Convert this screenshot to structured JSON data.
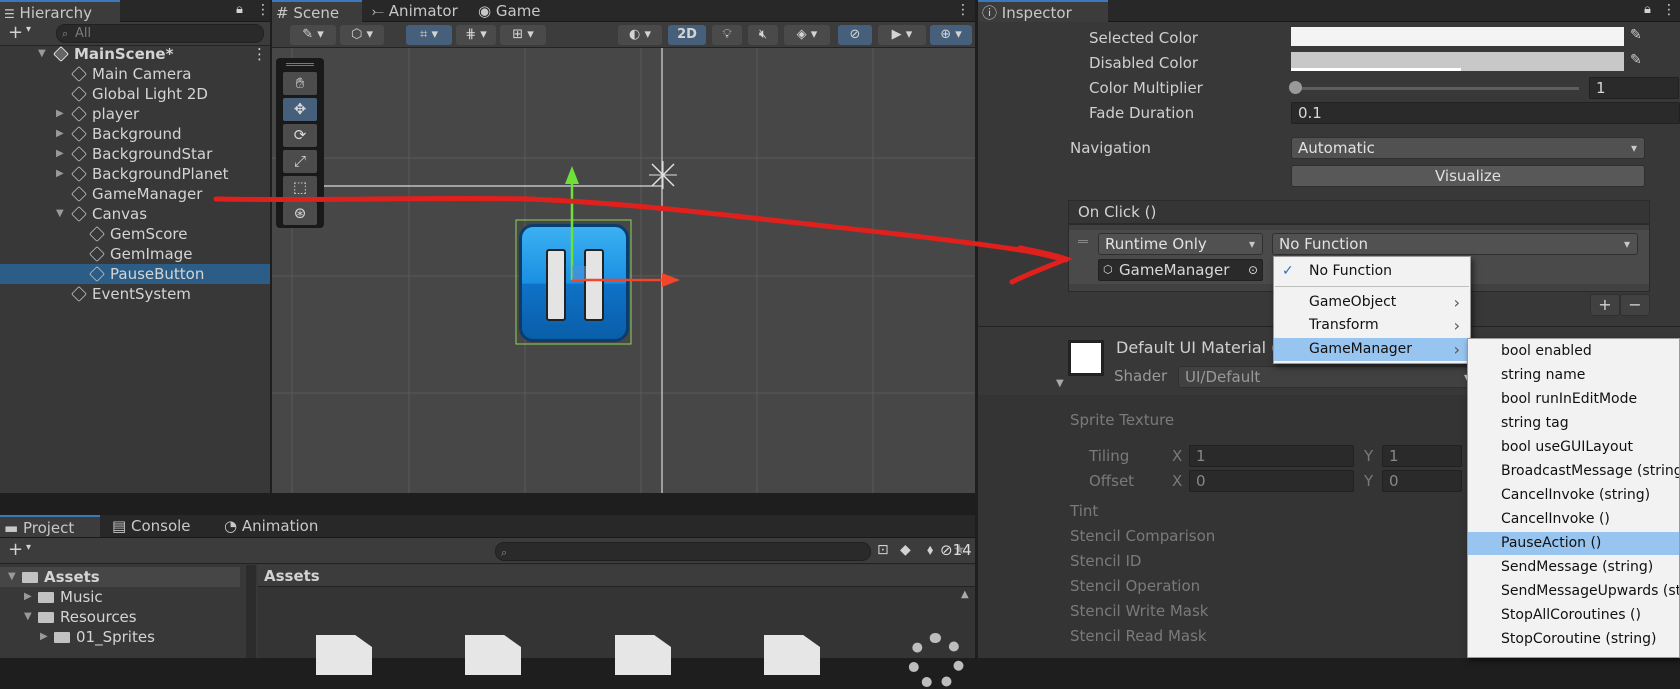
{
  "hierarchy": {
    "tab": "Hierarchy",
    "search_placeholder": "All",
    "items": [
      {
        "label": "MainScene*",
        "indent": 0,
        "arrow": "open",
        "bold": true,
        "scene": true
      },
      {
        "label": "Main Camera",
        "indent": 1,
        "arrow": ""
      },
      {
        "label": "Global Light 2D",
        "indent": 1,
        "arrow": ""
      },
      {
        "label": "player",
        "indent": 1,
        "arrow": "closed"
      },
      {
        "label": "Background",
        "indent": 1,
        "arrow": "closed"
      },
      {
        "label": "BackgroundStar",
        "indent": 1,
        "arrow": "closed"
      },
      {
        "label": "BackgroundPlanet",
        "indent": 1,
        "arrow": "closed"
      },
      {
        "label": "GameManager",
        "indent": 1,
        "arrow": ""
      },
      {
        "label": "Canvas",
        "indent": 1,
        "arrow": "open"
      },
      {
        "label": "GemScore",
        "indent": 2,
        "arrow": ""
      },
      {
        "label": "GemImage",
        "indent": 2,
        "arrow": ""
      },
      {
        "label": "PauseButton",
        "indent": 2,
        "arrow": "",
        "selected": true
      },
      {
        "label": "EventSystem",
        "indent": 1,
        "arrow": ""
      }
    ]
  },
  "scene": {
    "tabs": [
      "Scene",
      "Animator",
      "Game"
    ],
    "mode_2d": "2D"
  },
  "project": {
    "tabs": [
      "Project",
      "Console",
      "Animation"
    ],
    "hidden_count": "14",
    "assets_header": "Assets",
    "tree": [
      {
        "label": "Assets",
        "indent": 0,
        "arrow": "open"
      },
      {
        "label": "Music",
        "indent": 1,
        "arrow": "closed"
      },
      {
        "label": "Resources",
        "indent": 1,
        "arrow": "open"
      },
      {
        "label": "01_Sprites",
        "indent": 2,
        "arrow": "closed"
      }
    ]
  },
  "inspector": {
    "tab": "Inspector",
    "selected_color_label": "Selected Color",
    "disabled_color_label": "Disabled Color",
    "color_multiplier_label": "Color Multiplier",
    "color_multiplier_value": "1",
    "fade_duration_label": "Fade Duration",
    "fade_duration_value": "0.1",
    "navigation_label": "Navigation",
    "navigation_value": "Automatic",
    "visualize_label": "Visualize",
    "on_click_label": "On Click ()",
    "runtime_value": "Runtime Only",
    "function_value": "No Function",
    "target_object": "GameManager",
    "plus": "+",
    "minus": "−",
    "material_name": "Default UI Material (",
    "shader_label": "Shader",
    "shader_value": "UI/Default",
    "sprite_texture_label": "Sprite Texture",
    "tiling_label": "Tiling",
    "offset_label": "Offset",
    "x_label": "X",
    "y_label": "Y",
    "tiling_x": "1",
    "tiling_y": "1",
    "offset_x": "0",
    "offset_y": "0",
    "lower_props": [
      "Tint",
      "Stencil Comparison",
      "Stencil ID",
      "Stencil Operation",
      "Stencil Write Mask",
      "Stencil Read Mask"
    ]
  },
  "function_menu": {
    "items": [
      {
        "label": "No Function",
        "checked": true
      },
      {
        "label": "GameObject",
        "submenu": true
      },
      {
        "label": "Transform",
        "submenu": true
      },
      {
        "label": "GameManager",
        "submenu": true,
        "selected": true
      }
    ]
  },
  "gamemanager_menu": {
    "items": [
      "bool enabled",
      "string name",
      "bool runInEditMode",
      "string tag",
      "bool useGUILayout",
      "BroadcastMessage (string)",
      "CancelInvoke (string)",
      "CancelInvoke ()",
      "PauseAction ()",
      "SendMessage (string)",
      "SendMessageUpwards (string)",
      "StopAllCoroutines ()",
      "StopCoroutine (string)"
    ],
    "selected_index": 8
  },
  "colors": {
    "accent": "#2c5d87",
    "annotation": "#e0201c",
    "selection": "#98c4f0",
    "button_blue": "#1a8ee0"
  }
}
